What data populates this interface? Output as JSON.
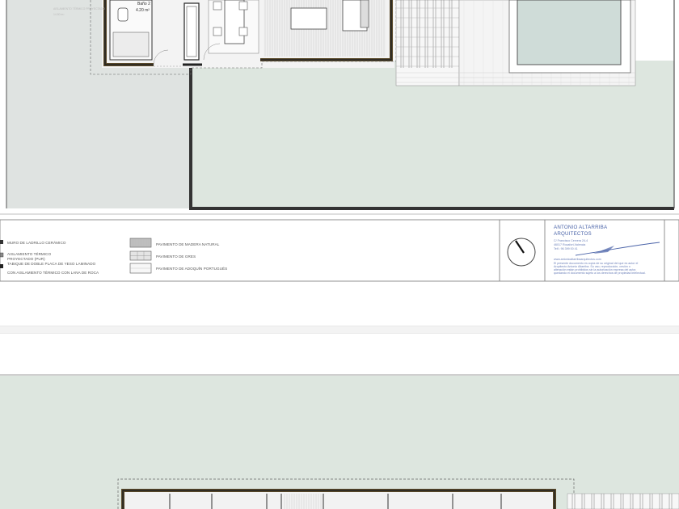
{
  "plan_top": {
    "room_label_name": "Baño 2",
    "room_label_area": "4.20 m²",
    "faded_text_line1": "AISLAMIENTO TÉRMICO PROYECTADO",
    "faded_text_line2": "14.50 m²"
  },
  "legend": {
    "left_items": [
      {
        "label": "MURO DE LADRILLO CERÁMICO"
      },
      {
        "label": "AISLAMIENTO TÉRMICO\nPROYECTADO (PUR)"
      },
      {
        "label": "TABIQUE DE DOBLE PLACA DE YESO LAMINADO\nCON AISLAMIENTO TÉRMICO CON LANA DE ROCA"
      }
    ],
    "right_items": [
      {
        "label": "PAVIMENTO DE MADERA NATURAL"
      },
      {
        "label": "PAVIMENTO DE GRES"
      },
      {
        "label": "PAVIMENTO DE ADOQUÍN PORTUGUÉS"
      }
    ]
  },
  "title_block": {
    "firm_line1": "ANTONIO ALTARRIBA",
    "firm_line2": "ARQUITECTOS",
    "address_line1": "C/ Francisco Cervera 24-4",
    "address_line2": "46017 Rocafort-Valencia",
    "address_line3": "Telf.: 96 399 00 41",
    "web": "www.antonioaltarribaarquitectos.com",
    "note_lines": [
      "El presente documento es copia de su original del que es autor el",
      "Arquitecto Antonio Altarriba. Su uso, reproducción, cesión o",
      "alteración están prohibidos sin la autorización expresa del autor,",
      "quedando el documento sujeto a los derechos de propiedad intelectual."
    ]
  },
  "colors": {
    "garden": "#dde6df",
    "wall": "#3a3a3a",
    "paving": "#f2f2f2",
    "pool": "#cfdcd8",
    "accent_blue": "#4a63a8"
  }
}
